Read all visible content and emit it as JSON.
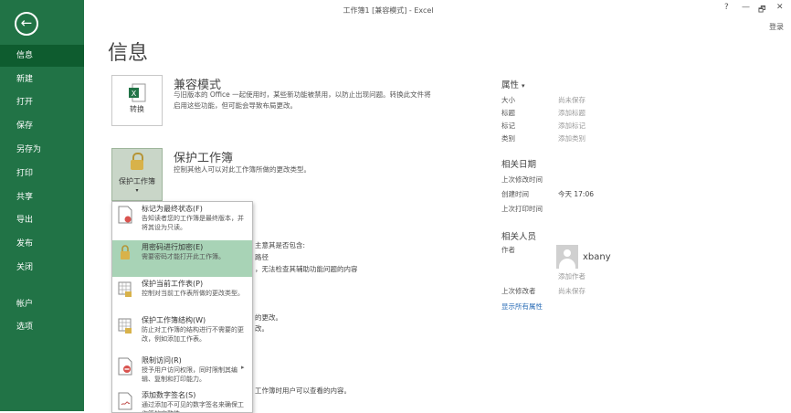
{
  "window": {
    "title": "工作簿1 [兼容模式] - Excel",
    "help": "?",
    "minimize": "—",
    "restore": "🗗",
    "close": "✕",
    "login": "登录"
  },
  "sidebar": {
    "back": "←",
    "items": [
      {
        "label": "信息"
      },
      {
        "label": "新建"
      },
      {
        "label": "打开"
      },
      {
        "label": "保存"
      },
      {
        "label": "另存为"
      },
      {
        "label": "打印"
      },
      {
        "label": "共享"
      },
      {
        "label": "导出"
      },
      {
        "label": "发布"
      },
      {
        "label": "关闭"
      },
      {
        "label": "帐户"
      },
      {
        "label": "选项"
      }
    ]
  },
  "main": {
    "title": "信息",
    "compat": {
      "button_label": "转换",
      "title": "兼容模式",
      "desc_line1": "与旧版本的 Office 一起使用时，某些新功能被禁用，以防止出现问题。转换此文件将",
      "desc_line2": "启用这些功能，但可能会导致布局更改。"
    },
    "protect": {
      "button_label": "保护工作簿",
      "caret": "▾",
      "title": "保护工作簿",
      "desc": "控制其他人可以对此工作簿所做的更改类型。"
    },
    "inspect_partial": {
      "line1": "主意其是否包含:",
      "line2": "路径",
      "line3": "，无法检查其辅助功能问题的内容"
    },
    "manage_partial": {
      "line1": "的更改。",
      "line2": "改。"
    },
    "browser_partial": {
      "line1": "工作簿时用户可以查看的内容。"
    }
  },
  "dropdown": {
    "items": [
      {
        "title": "标记为最终状态(F)",
        "desc": "告知读者您的工作簿是最终版本，并将其设为只读。"
      },
      {
        "title": "用密码进行加密(E)",
        "desc": "需要密码才能打开此工作簿。"
      },
      {
        "title": "保护当前工作表(P)",
        "desc": "控制对当前工作表所做的更改类型。"
      },
      {
        "title": "保护工作簿结构(W)",
        "desc": "防止对工作簿的结构进行不需要的更改，例如添加工作表。"
      },
      {
        "title": "限制访问(R)",
        "desc": "授予用户访问权限，同时限制其编辑、复制和打印能力。",
        "arrow": "▸"
      },
      {
        "title": "添加数字签名(S)",
        "desc": "通过添加不可见的数字签名来确保工作簿的完整性"
      }
    ]
  },
  "properties": {
    "title": "属性",
    "caret": "▾",
    "rows": [
      {
        "label": "大小",
        "value": "尚未保存"
      },
      {
        "label": "标题",
        "value": "添加标题"
      },
      {
        "label": "标记",
        "value": "添加标记"
      },
      {
        "label": "类别",
        "value": "添加类别"
      }
    ],
    "dates_title": "相关日期",
    "dates": [
      {
        "label": "上次修改时间",
        "value": ""
      },
      {
        "label": "创建时间",
        "value": "今天 17:06"
      },
      {
        "label": "上次打印时间",
        "value": ""
      }
    ],
    "people_title": "相关人员",
    "author_label": "作者",
    "author_name": "xbany",
    "add_author": "添加作者",
    "last_modified_by_label": "上次修改者",
    "last_modified_by_value": "尚未保存",
    "show_all": "显示所有属性"
  }
}
